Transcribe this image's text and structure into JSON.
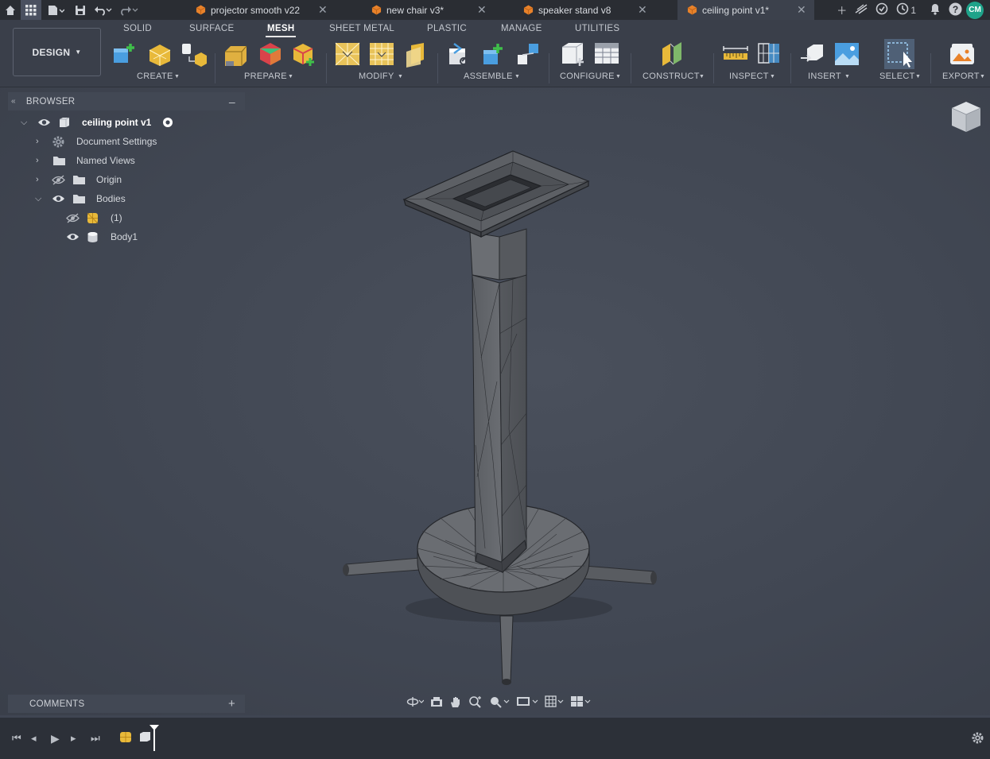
{
  "titlebar": {
    "tabs": [
      {
        "label": "projector smooth v22",
        "active": false
      },
      {
        "label": "new chair v3*",
        "active": false
      },
      {
        "label": "speaker stand v8",
        "active": false
      },
      {
        "label": "ceiling point v1*",
        "active": true
      }
    ],
    "clock_count": "1",
    "user_initials": "CM"
  },
  "ribbon": {
    "workspace": "DESIGN",
    "tabs": [
      "SOLID",
      "SURFACE",
      "MESH",
      "SHEET METAL",
      "PLASTIC",
      "MANAGE",
      "UTILITIES"
    ],
    "active_tab": "MESH",
    "groups": [
      "CREATE",
      "PREPARE",
      "MODIFY",
      "ASSEMBLE",
      "CONFIGURE",
      "CONSTRUCT",
      "INSPECT",
      "INSERT",
      "SELECT",
      "EXPORT"
    ]
  },
  "browser": {
    "title": "BROWSER",
    "root": "ceiling point v1",
    "items": [
      {
        "label": "Document Settings"
      },
      {
        "label": "Named Views"
      },
      {
        "label": "Origin"
      },
      {
        "label": "Bodies"
      },
      {
        "label": "(1)"
      },
      {
        "label": "Body1"
      }
    ]
  },
  "comments": {
    "title": "COMMENTS"
  },
  "colors": {
    "accent": "#1fa38a",
    "tab_icon": "#e8822a",
    "viewport": "#434955"
  }
}
